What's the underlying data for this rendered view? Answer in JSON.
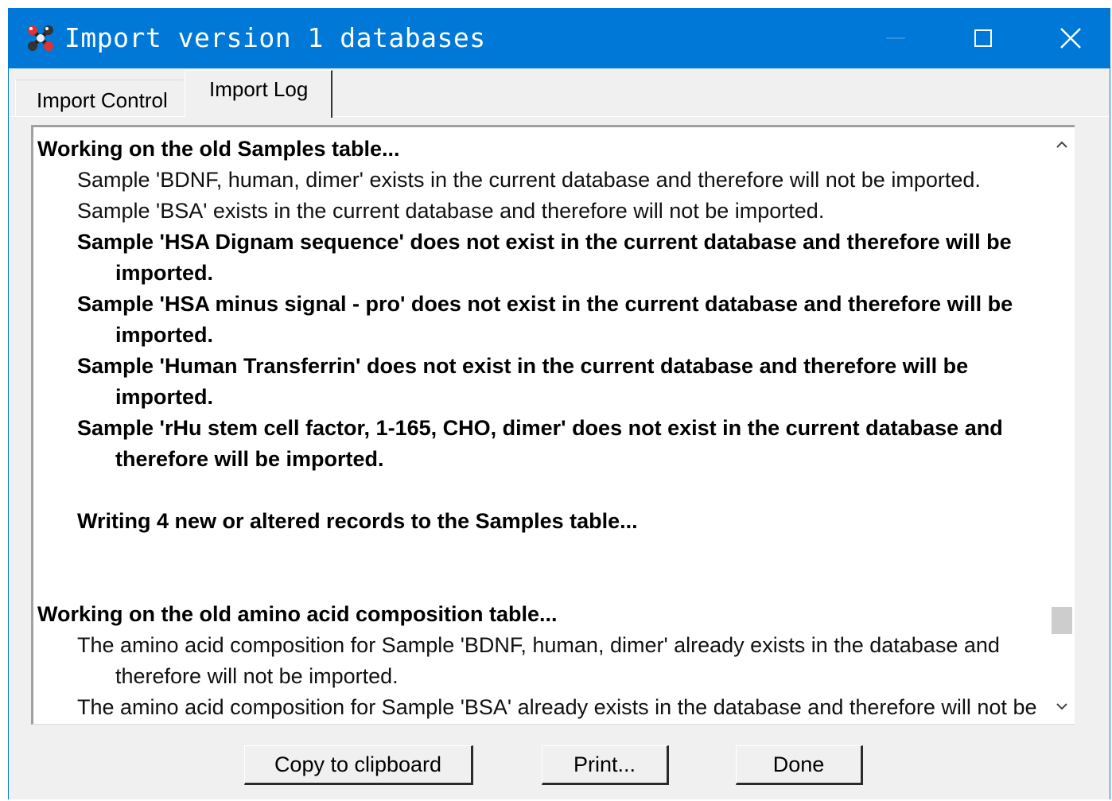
{
  "window": {
    "title": "Import version 1 databases",
    "accent_color": "#0078d7",
    "app_icon": "molecule-icon",
    "controls": [
      "minimize-icon",
      "maximize-icon",
      "close-icon"
    ]
  },
  "tabs": [
    {
      "label": "Import Control",
      "selected": false
    },
    {
      "label": "Import Log",
      "selected": true
    }
  ],
  "log": {
    "lines": [
      "Working on the old Samples table...",
      "Sample 'BDNF, human, dimer' exists in the current database and therefore will not be imported.",
      "Sample 'BSA' exists in the current database and therefore will not be imported.",
      "Sample 'HSA Dignam sequence' does not exist in the current database and therefore will be imported.",
      "Sample 'HSA minus signal - pro' does not exist in the current database and therefore will be imported.",
      "Sample 'Human Transferrin' does not exist in the current database and therefore will be imported.",
      "Sample 'rHu stem cell factor, 1-165, CHO, dimer' does not exist in the current database and therefore will be imported.",
      "Writing 4 new or altered records to the Samples table...",
      "Working on the old amino acid composition table...",
      "The amino acid composition for Sample 'BDNF, human, dimer' already exists in the database and therefore will not be imported.",
      "The amino acid composition for Sample 'BSA' already exists in the database and therefore will not be"
    ],
    "scrollbar": {
      "position": 0.79
    }
  },
  "buttons": {
    "copy": "Copy to clipboard",
    "print": "Print...",
    "done": "Done"
  }
}
